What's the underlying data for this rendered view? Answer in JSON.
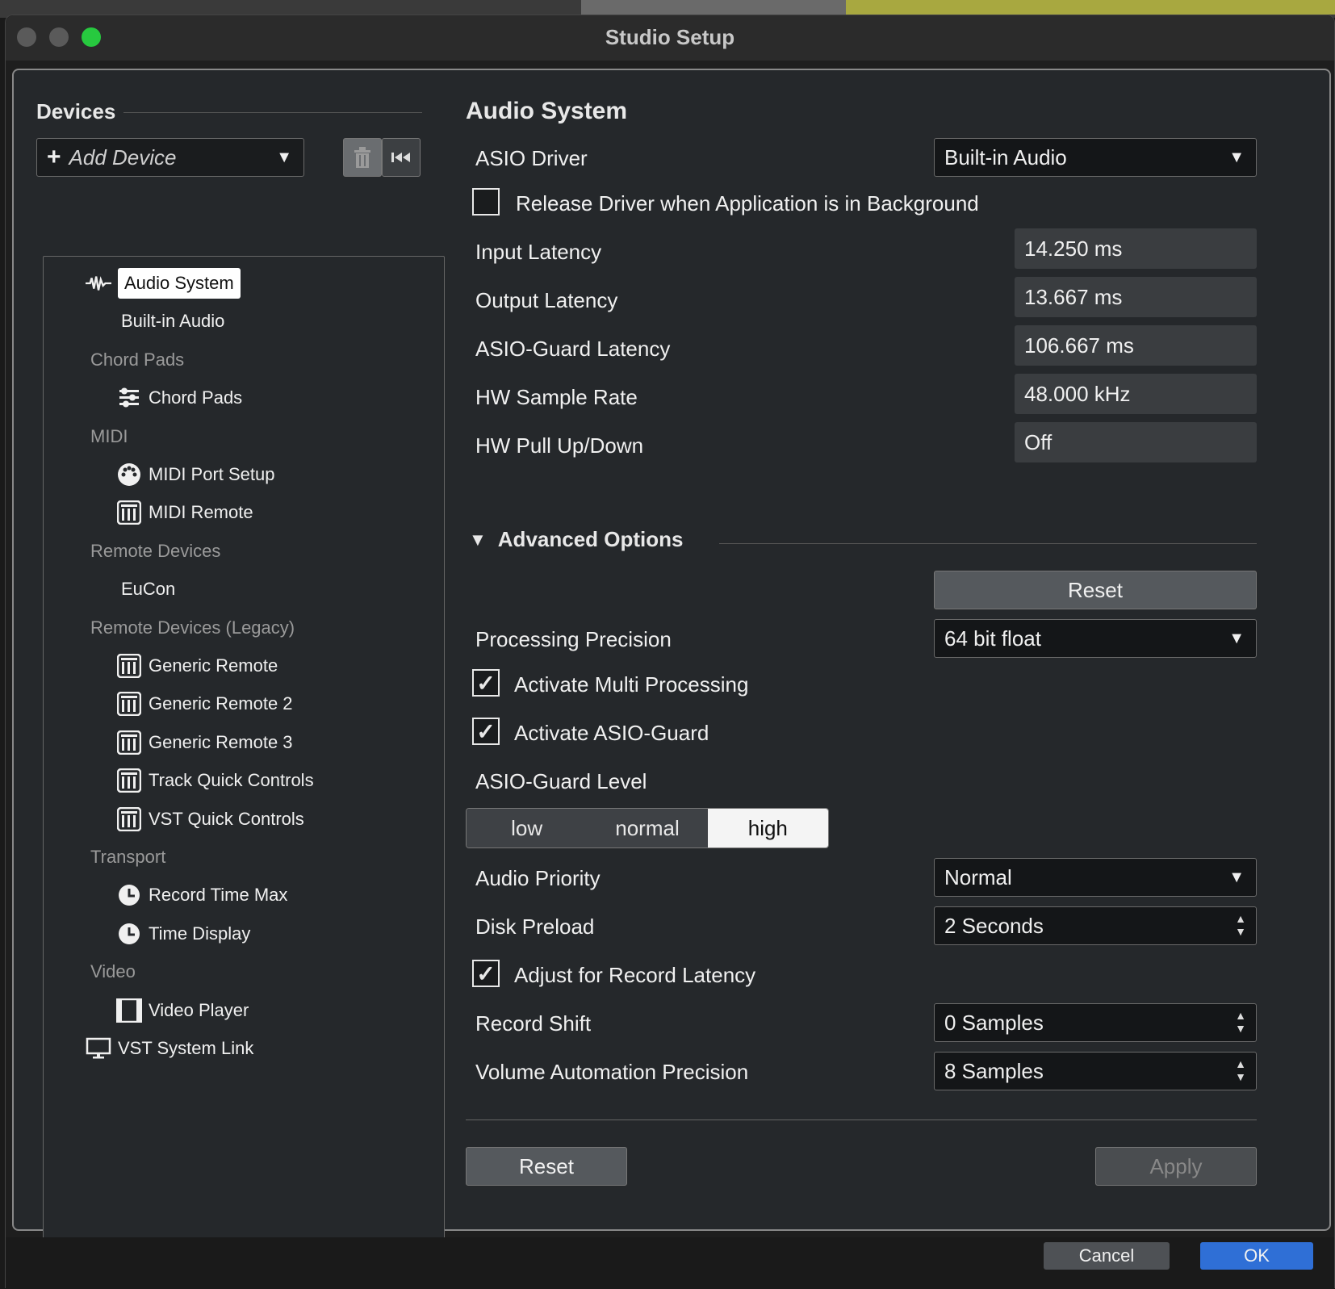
{
  "window": {
    "title": "Studio Setup"
  },
  "devices": {
    "heading": "Devices",
    "add_device": "Add Device",
    "tree": [
      {
        "type": "device",
        "label": "Audio System",
        "icon": "waveform-icon",
        "selected": true,
        "indent": 0
      },
      {
        "type": "device",
        "label": "Built-in Audio",
        "icon": "",
        "indent": 1
      },
      {
        "type": "category",
        "label": "Chord Pads"
      },
      {
        "type": "device",
        "label": "Chord Pads",
        "icon": "chord-pads-icon",
        "indent": 1
      },
      {
        "type": "category",
        "label": "MIDI"
      },
      {
        "type": "device",
        "label": "MIDI Port Setup",
        "icon": "midi-port-icon",
        "indent": 1
      },
      {
        "type": "device",
        "label": "MIDI Remote",
        "icon": "remote-icon",
        "indent": 1
      },
      {
        "type": "category",
        "label": "Remote Devices"
      },
      {
        "type": "device",
        "label": "EuCon",
        "icon": "",
        "indent": 1
      },
      {
        "type": "category",
        "label": "Remote Devices (Legacy)"
      },
      {
        "type": "device",
        "label": "Generic Remote",
        "icon": "remote-icon",
        "indent": 1
      },
      {
        "type": "device",
        "label": "Generic Remote 2",
        "icon": "remote-icon",
        "indent": 1
      },
      {
        "type": "device",
        "label": "Generic Remote 3",
        "icon": "remote-icon",
        "indent": 1
      },
      {
        "type": "device",
        "label": "Track Quick Controls",
        "icon": "remote-icon",
        "indent": 1
      },
      {
        "type": "device",
        "label": "VST Quick Controls",
        "icon": "remote-icon",
        "indent": 1
      },
      {
        "type": "category",
        "label": "Transport"
      },
      {
        "type": "device",
        "label": "Record Time Max",
        "icon": "clock-icon",
        "indent": 1
      },
      {
        "type": "device",
        "label": "Time Display",
        "icon": "clock-icon",
        "indent": 1
      },
      {
        "type": "category",
        "label": "Video"
      },
      {
        "type": "device",
        "label": "Video Player",
        "icon": "film-icon",
        "indent": 1
      },
      {
        "type": "device",
        "label": "VST System Link",
        "icon": "monitor-icon",
        "indent": 0
      }
    ]
  },
  "audio_system": {
    "heading": "Audio System",
    "asio_driver_label": "ASIO Driver",
    "asio_driver_value": "Built-in Audio",
    "release_driver_label": "Release Driver when Application is in Background",
    "release_driver_checked": false,
    "rows": [
      {
        "label": "Input Latency",
        "value": "14.250 ms"
      },
      {
        "label": "Output Latency",
        "value": "13.667 ms"
      },
      {
        "label": "ASIO-Guard Latency",
        "value": "106.667 ms"
      },
      {
        "label": "HW Sample Rate",
        "value": "48.000 kHz"
      },
      {
        "label": "HW Pull Up/Down",
        "value": "Off"
      }
    ]
  },
  "advanced": {
    "heading": "Advanced Options",
    "reset_label": "Reset",
    "processing_precision_label": "Processing Precision",
    "processing_precision_value": "64 bit float",
    "multi_processing_label": "Activate Multi Processing",
    "multi_processing_checked": true,
    "asio_guard_label": "Activate ASIO-Guard",
    "asio_guard_checked": true,
    "asio_guard_level_label": "ASIO-Guard Level",
    "asio_guard_levels": [
      "low",
      "normal",
      "high"
    ],
    "asio_guard_level_selected": "high",
    "audio_priority_label": "Audio Priority",
    "audio_priority_value": "Normal",
    "disk_preload_label": "Disk Preload",
    "disk_preload_value": "2 Seconds",
    "adjust_record_latency_label": "Adjust for Record Latency",
    "adjust_record_latency_checked": true,
    "record_shift_label": "Record Shift",
    "record_shift_value": "0 Samples",
    "volume_precision_label": "Volume Automation Precision",
    "volume_precision_value": "8 Samples"
  },
  "bottom": {
    "reset_label": "Reset",
    "apply_label": "Apply"
  },
  "footer": {
    "cancel_label": "Cancel",
    "ok_label": "OK"
  },
  "colors": {
    "ok_button": "#2f6fd6",
    "panel": "#25282b",
    "maximize": "#27c93f"
  }
}
